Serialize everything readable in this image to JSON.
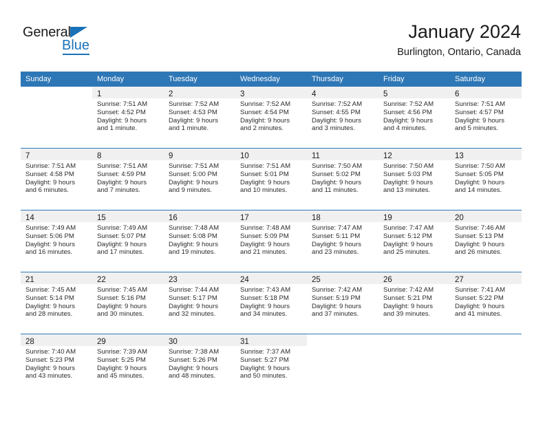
{
  "brand": {
    "name_top": "General",
    "name_bottom": "Blue",
    "accent_color": "#1a72b8"
  },
  "header": {
    "title": "January 2024",
    "subtitle": "Burlington, Ontario, Canada"
  },
  "theme": {
    "header_row_bg": "#2e77b6",
    "header_row_text": "#ffffff",
    "daynum_strip_bg": "#f0f0f0",
    "week_divider": "#2e77b6"
  },
  "weekdays": [
    "Sunday",
    "Monday",
    "Tuesday",
    "Wednesday",
    "Thursday",
    "Friday",
    "Saturday"
  ],
  "weeks": [
    [
      {
        "day": "",
        "sunrise": "",
        "sunset": "",
        "daylight_line1": "",
        "daylight_line2": "",
        "blank": true
      },
      {
        "day": "1",
        "sunrise": "Sunrise: 7:51 AM",
        "sunset": "Sunset: 4:52 PM",
        "daylight_line1": "Daylight: 9 hours",
        "daylight_line2": "and 1 minute."
      },
      {
        "day": "2",
        "sunrise": "Sunrise: 7:52 AM",
        "sunset": "Sunset: 4:53 PM",
        "daylight_line1": "Daylight: 9 hours",
        "daylight_line2": "and 1 minute."
      },
      {
        "day": "3",
        "sunrise": "Sunrise: 7:52 AM",
        "sunset": "Sunset: 4:54 PM",
        "daylight_line1": "Daylight: 9 hours",
        "daylight_line2": "and 2 minutes."
      },
      {
        "day": "4",
        "sunrise": "Sunrise: 7:52 AM",
        "sunset": "Sunset: 4:55 PM",
        "daylight_line1": "Daylight: 9 hours",
        "daylight_line2": "and 3 minutes."
      },
      {
        "day": "5",
        "sunrise": "Sunrise: 7:52 AM",
        "sunset": "Sunset: 4:56 PM",
        "daylight_line1": "Daylight: 9 hours",
        "daylight_line2": "and 4 minutes."
      },
      {
        "day": "6",
        "sunrise": "Sunrise: 7:51 AM",
        "sunset": "Sunset: 4:57 PM",
        "daylight_line1": "Daylight: 9 hours",
        "daylight_line2": "and 5 minutes."
      }
    ],
    [
      {
        "day": "7",
        "sunrise": "Sunrise: 7:51 AM",
        "sunset": "Sunset: 4:58 PM",
        "daylight_line1": "Daylight: 9 hours",
        "daylight_line2": "and 6 minutes."
      },
      {
        "day": "8",
        "sunrise": "Sunrise: 7:51 AM",
        "sunset": "Sunset: 4:59 PM",
        "daylight_line1": "Daylight: 9 hours",
        "daylight_line2": "and 7 minutes."
      },
      {
        "day": "9",
        "sunrise": "Sunrise: 7:51 AM",
        "sunset": "Sunset: 5:00 PM",
        "daylight_line1": "Daylight: 9 hours",
        "daylight_line2": "and 9 minutes."
      },
      {
        "day": "10",
        "sunrise": "Sunrise: 7:51 AM",
        "sunset": "Sunset: 5:01 PM",
        "daylight_line1": "Daylight: 9 hours",
        "daylight_line2": "and 10 minutes."
      },
      {
        "day": "11",
        "sunrise": "Sunrise: 7:50 AM",
        "sunset": "Sunset: 5:02 PM",
        "daylight_line1": "Daylight: 9 hours",
        "daylight_line2": "and 11 minutes."
      },
      {
        "day": "12",
        "sunrise": "Sunrise: 7:50 AM",
        "sunset": "Sunset: 5:03 PM",
        "daylight_line1": "Daylight: 9 hours",
        "daylight_line2": "and 13 minutes."
      },
      {
        "day": "13",
        "sunrise": "Sunrise: 7:50 AM",
        "sunset": "Sunset: 5:05 PM",
        "daylight_line1": "Daylight: 9 hours",
        "daylight_line2": "and 14 minutes."
      }
    ],
    [
      {
        "day": "14",
        "sunrise": "Sunrise: 7:49 AM",
        "sunset": "Sunset: 5:06 PM",
        "daylight_line1": "Daylight: 9 hours",
        "daylight_line2": "and 16 minutes."
      },
      {
        "day": "15",
        "sunrise": "Sunrise: 7:49 AM",
        "sunset": "Sunset: 5:07 PM",
        "daylight_line1": "Daylight: 9 hours",
        "daylight_line2": "and 17 minutes."
      },
      {
        "day": "16",
        "sunrise": "Sunrise: 7:48 AM",
        "sunset": "Sunset: 5:08 PM",
        "daylight_line1": "Daylight: 9 hours",
        "daylight_line2": "and 19 minutes."
      },
      {
        "day": "17",
        "sunrise": "Sunrise: 7:48 AM",
        "sunset": "Sunset: 5:09 PM",
        "daylight_line1": "Daylight: 9 hours",
        "daylight_line2": "and 21 minutes."
      },
      {
        "day": "18",
        "sunrise": "Sunrise: 7:47 AM",
        "sunset": "Sunset: 5:11 PM",
        "daylight_line1": "Daylight: 9 hours",
        "daylight_line2": "and 23 minutes."
      },
      {
        "day": "19",
        "sunrise": "Sunrise: 7:47 AM",
        "sunset": "Sunset: 5:12 PM",
        "daylight_line1": "Daylight: 9 hours",
        "daylight_line2": "and 25 minutes."
      },
      {
        "day": "20",
        "sunrise": "Sunrise: 7:46 AM",
        "sunset": "Sunset: 5:13 PM",
        "daylight_line1": "Daylight: 9 hours",
        "daylight_line2": "and 26 minutes."
      }
    ],
    [
      {
        "day": "21",
        "sunrise": "Sunrise: 7:45 AM",
        "sunset": "Sunset: 5:14 PM",
        "daylight_line1": "Daylight: 9 hours",
        "daylight_line2": "and 28 minutes."
      },
      {
        "day": "22",
        "sunrise": "Sunrise: 7:45 AM",
        "sunset": "Sunset: 5:16 PM",
        "daylight_line1": "Daylight: 9 hours",
        "daylight_line2": "and 30 minutes."
      },
      {
        "day": "23",
        "sunrise": "Sunrise: 7:44 AM",
        "sunset": "Sunset: 5:17 PM",
        "daylight_line1": "Daylight: 9 hours",
        "daylight_line2": "and 32 minutes."
      },
      {
        "day": "24",
        "sunrise": "Sunrise: 7:43 AM",
        "sunset": "Sunset: 5:18 PM",
        "daylight_line1": "Daylight: 9 hours",
        "daylight_line2": "and 34 minutes."
      },
      {
        "day": "25",
        "sunrise": "Sunrise: 7:42 AM",
        "sunset": "Sunset: 5:19 PM",
        "daylight_line1": "Daylight: 9 hours",
        "daylight_line2": "and 37 minutes."
      },
      {
        "day": "26",
        "sunrise": "Sunrise: 7:42 AM",
        "sunset": "Sunset: 5:21 PM",
        "daylight_line1": "Daylight: 9 hours",
        "daylight_line2": "and 39 minutes."
      },
      {
        "day": "27",
        "sunrise": "Sunrise: 7:41 AM",
        "sunset": "Sunset: 5:22 PM",
        "daylight_line1": "Daylight: 9 hours",
        "daylight_line2": "and 41 minutes."
      }
    ],
    [
      {
        "day": "28",
        "sunrise": "Sunrise: 7:40 AM",
        "sunset": "Sunset: 5:23 PM",
        "daylight_line1": "Daylight: 9 hours",
        "daylight_line2": "and 43 minutes."
      },
      {
        "day": "29",
        "sunrise": "Sunrise: 7:39 AM",
        "sunset": "Sunset: 5:25 PM",
        "daylight_line1": "Daylight: 9 hours",
        "daylight_line2": "and 45 minutes."
      },
      {
        "day": "30",
        "sunrise": "Sunrise: 7:38 AM",
        "sunset": "Sunset: 5:26 PM",
        "daylight_line1": "Daylight: 9 hours",
        "daylight_line2": "and 48 minutes."
      },
      {
        "day": "31",
        "sunrise": "Sunrise: 7:37 AM",
        "sunset": "Sunset: 5:27 PM",
        "daylight_line1": "Daylight: 9 hours",
        "daylight_line2": "and 50 minutes."
      },
      {
        "day": "",
        "sunrise": "",
        "sunset": "",
        "daylight_line1": "",
        "daylight_line2": "",
        "blank": true
      },
      {
        "day": "",
        "sunrise": "",
        "sunset": "",
        "daylight_line1": "",
        "daylight_line2": "",
        "blank": true
      },
      {
        "day": "",
        "sunrise": "",
        "sunset": "",
        "daylight_line1": "",
        "daylight_line2": "",
        "blank": true
      }
    ]
  ]
}
